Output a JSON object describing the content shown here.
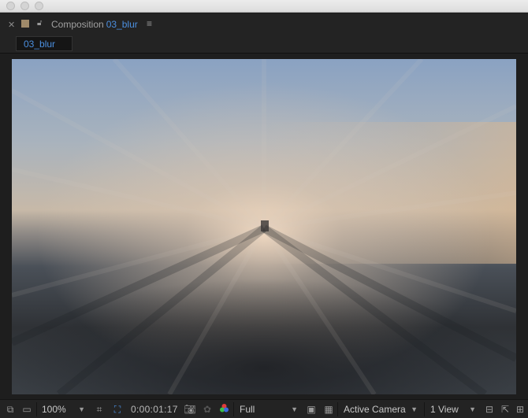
{
  "panel": {
    "label": "Composition",
    "comp_name": "03_blur",
    "menu_icon": "hamburger-icon"
  },
  "tab": {
    "label": "03_blur"
  },
  "toolbar": {
    "magnification": "100%",
    "timecode": "0:00:01:17",
    "resolution": "Full",
    "camera": "Active Camera",
    "views": "1 View"
  },
  "colors": {
    "accent": "#4b8fe0",
    "panel_bg": "#232323",
    "swatch": "#a08a6a"
  }
}
